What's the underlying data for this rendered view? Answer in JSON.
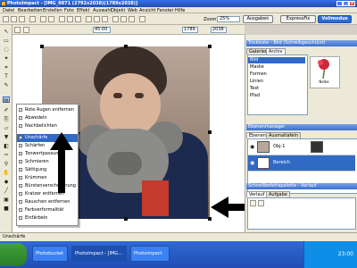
{
  "window": {
    "title": "PhotoImpact - [IMG_8871 (2792x2038)(1789x2038)]"
  },
  "menu": [
    "Datei",
    "Bearbeiten",
    "Erstellen",
    "Foto",
    "Effekt",
    "Auswahl",
    "Objekt",
    "Web",
    "Ansicht",
    "Fenster",
    "Hilfe"
  ],
  "toolbar": {
    "zoom_label": "Zoom",
    "zoom_value": "25%",
    "output_label": "Ausgaben",
    "expressfix_label": "ExpressFix",
    "fullmode_label": "Vollmodus"
  },
  "optbar": {
    "value_a": "45:00",
    "value_b": "1789",
    "value_c": "2038"
  },
  "context_menu": {
    "items": [
      "Rote Augen entfernen",
      "Abwedeln",
      "Nachbelichten",
      "Unschärfe",
      "Schärfen",
      "Tonwertpassung",
      "Schmieren",
      "Sättigung",
      "Krümmen",
      "Bürstenverschmierung",
      "Kratzer entfernen",
      "Rauschen entfernen",
      "Farbverformalität",
      "Einfärbeln"
    ],
    "highlighted": "Unschärfe"
  },
  "library": {
    "title": "Trickkiste - Bild (Schreibgeschützt)",
    "tabs": [
      "Galerien",
      "Archiv"
    ],
    "active_tab": "Archiv",
    "tree": [
      "Bild",
      "Maske",
      "Formen",
      "Linien",
      "Text",
      "Pfad"
    ],
    "selected": "Bild",
    "preview_label": "Nelke"
  },
  "layers": {
    "title": "Ebenenmanager",
    "tabs": [
      "Ebenen",
      "Ausmaltafeln"
    ],
    "rows": [
      {
        "name": "Obj-1"
      },
      {
        "name": "Bereich"
      }
    ]
  },
  "quickpanel": {
    "title": "Schnellbefehlspalette - Verlauf",
    "tabs": [
      "Verlauf",
      "Aufgabe"
    ]
  },
  "status": {
    "text": "Unschärfe"
  },
  "taskbar": {
    "items": [
      "Photobucket",
      "PhotoImpact - [IMG...",
      "Photoimpact"
    ],
    "clock": "23:00"
  }
}
